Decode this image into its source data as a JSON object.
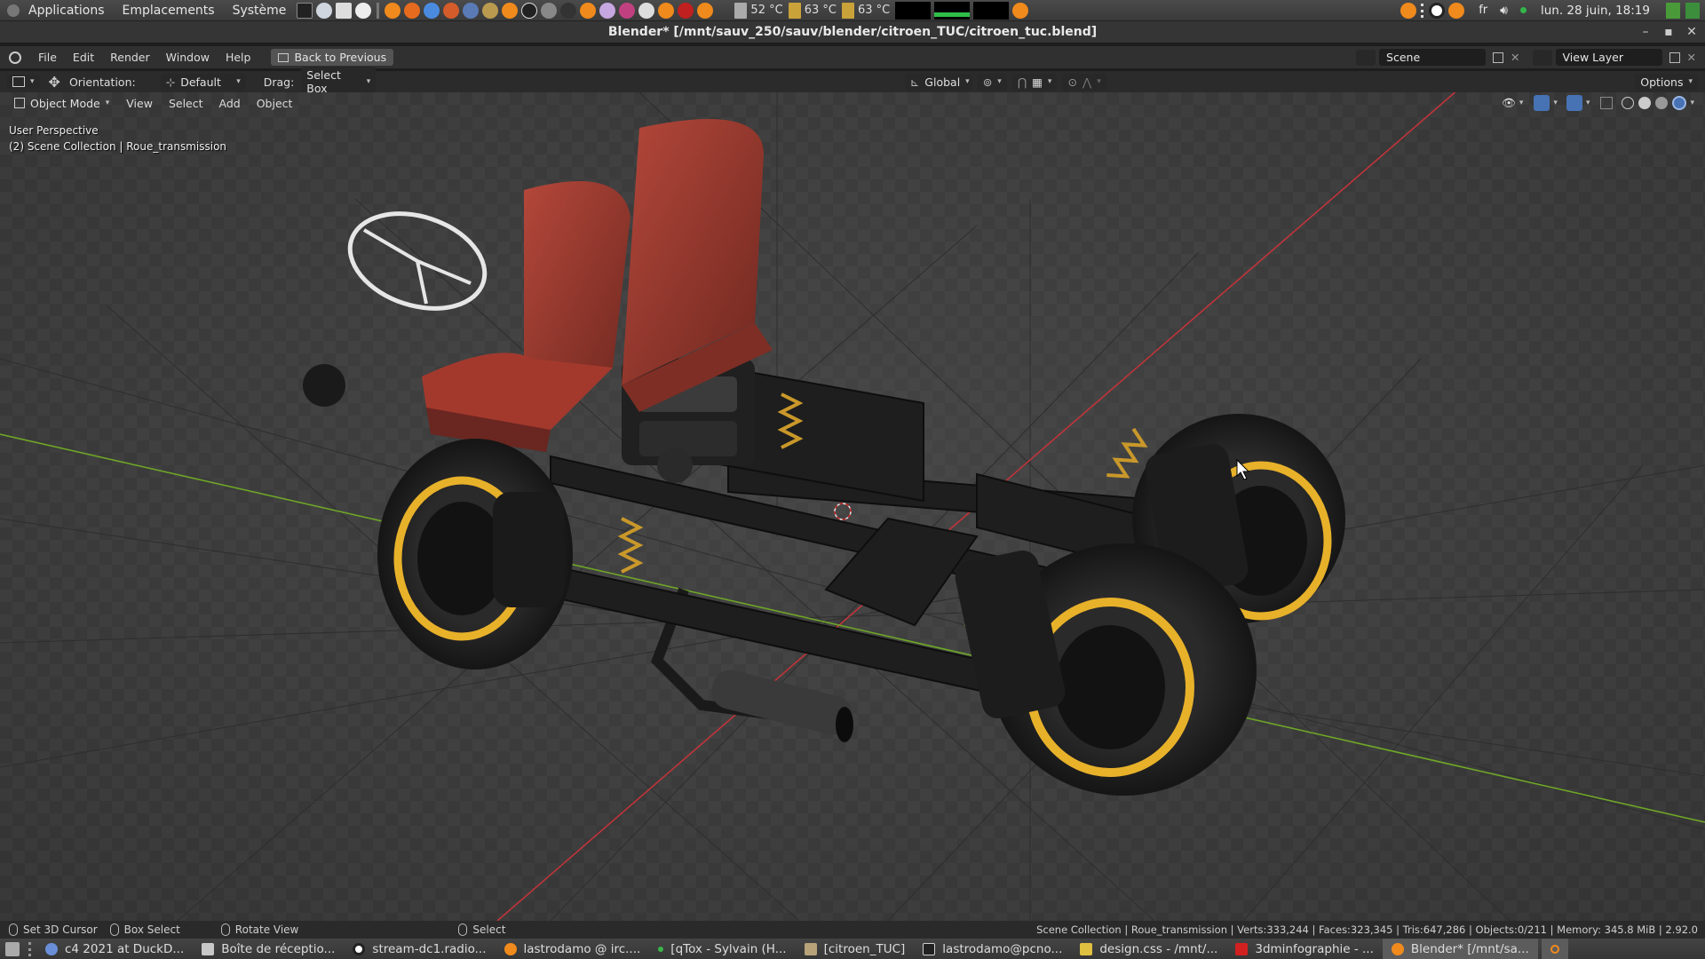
{
  "os_panel": {
    "menus": [
      "Applications",
      "Emplacements",
      "Système"
    ],
    "temps": [
      "52 °C",
      "63 °C",
      "63 °C"
    ],
    "keyboard_layout": "fr",
    "datetime": "lun. 28 juin, 18:19"
  },
  "window": {
    "title": "Blender* [/mnt/sauv_250/sauv/blender/citroen_TUC/citroen_tuc.blend]"
  },
  "topbar": {
    "menus": [
      "File",
      "Edit",
      "Render",
      "Window",
      "Help"
    ],
    "back_button": "Back to Previous",
    "scene_value": "Scene",
    "view_layer_value": "View Layer"
  },
  "tool_header": {
    "orientation_label": "Orientation:",
    "orientation_value": "Default",
    "drag_label": "Drag:",
    "drag_value": "Select Box",
    "transform_orientation": "Global",
    "options_label": "Options"
  },
  "viewport_header": {
    "mode": "Object Mode",
    "menus": [
      "View",
      "Select",
      "Add",
      "Object"
    ]
  },
  "viewport": {
    "perspective": "User Perspective",
    "collection_info": "(2) Scene Collection | Roue_transmission"
  },
  "statusbar": {
    "hints": [
      "Set 3D Cursor",
      "Box Select",
      "Rotate View",
      "Select"
    ],
    "stats": "Scene Collection | Roue_transmission | Verts:333,244 | Faces:323,345 | Tris:647,286 | Objects:0/211 | Memory: 345.8 MiB | 2.92.0"
  },
  "taskbar": {
    "items": [
      {
        "label": "c4 2021 at DuckD...",
        "icon_color": "#6a8fd8"
      },
      {
        "label": "Boîte de réceptio...",
        "icon_color": "#c8c8c8"
      },
      {
        "label": "stream-dc1.radio...",
        "icon_color": "#ffffff"
      },
      {
        "label": "lastrodamo @ irc....",
        "icon_color": "#f08a1c"
      },
      {
        "label": "[qTox - Sylvain (H...",
        "icon_color": "#3bb54a"
      },
      {
        "label": "[citroen_TUC]",
        "icon_color": "#b7a27a"
      },
      {
        "label": "lastrodamo@pcno...",
        "icon_color": "#d0d0d0"
      },
      {
        "label": "design.css - /mnt/...",
        "icon_color": "#e0c040"
      },
      {
        "label": "3dminfographie - ...",
        "icon_color": "#d02020"
      },
      {
        "label": "Blender* [/mnt/sa...",
        "icon_color": "#f08a1c"
      }
    ]
  },
  "colors": {
    "blender_orange": "#f08a1c",
    "x_axis": "#c0343a",
    "y_axis": "#6ea626",
    "rim_yellow": "#e8b12a",
    "seat_red": "#9a3a2e"
  }
}
